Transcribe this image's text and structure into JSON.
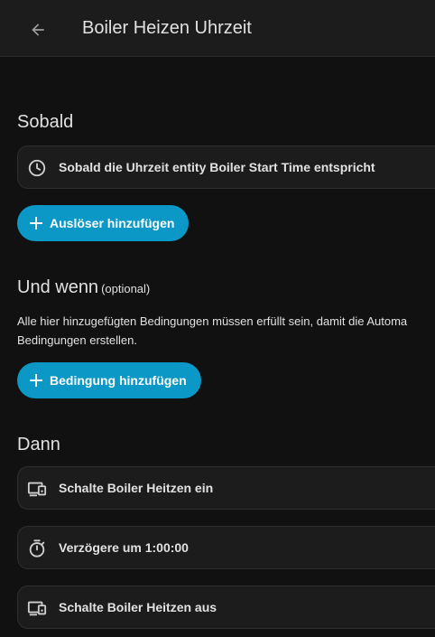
{
  "header": {
    "title": "Boiler Heizen Uhrzeit"
  },
  "triggers": {
    "title": "Sobald",
    "items": [
      {
        "label": "Sobald die Uhrzeit entity Boiler Start Time entspricht",
        "icon": "clock-icon"
      }
    ],
    "add_label": "Auslöser hinzufügen"
  },
  "conditions": {
    "title": "Und wenn",
    "optional_label": "(optional)",
    "description_line1": "Alle hier hinzugefügten Bedingungen müssen erfüllt sein, damit die Automa",
    "description_line2": "Bedingungen erstellen.",
    "add_label": "Bedingung hinzufügen"
  },
  "actions": {
    "title": "Dann",
    "items": [
      {
        "label": "Schalte Boiler Heitzen ein",
        "icon": "devices-icon"
      },
      {
        "label": "Verzögere um 1:00:00",
        "icon": "timer-icon"
      },
      {
        "label": "Schalte Boiler Heitzen aus",
        "icon": "devices-icon"
      }
    ]
  },
  "colors": {
    "accent": "#0b98c7",
    "background": "#111111",
    "card": "#1c1c1c"
  }
}
